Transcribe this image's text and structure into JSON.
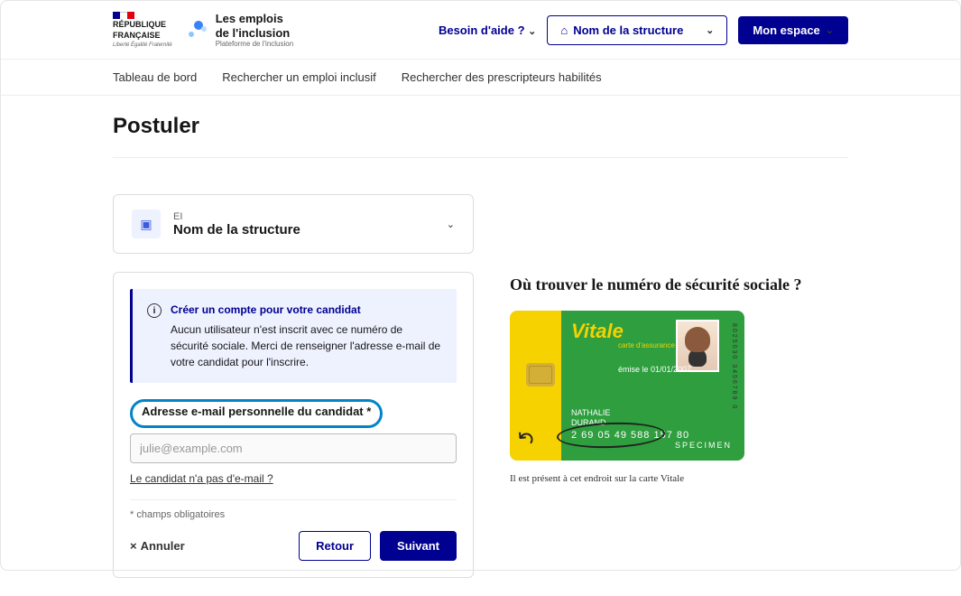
{
  "header": {
    "republic_line1": "République",
    "republic_line2": "Française",
    "motto": "Liberté Égalité Fraternité",
    "brand_line1": "Les emplois",
    "brand_line2": "de l'inclusion",
    "brand_sub": "Plateforme de l'inclusion",
    "help_label": "Besoin d'aide ?",
    "structure_label": "Nom de la structure",
    "account_label": "Mon espace"
  },
  "nav": {
    "item1": "Tableau de bord",
    "item2": "Rechercher un emploi inclusif",
    "item3": "Rechercher des prescripteurs habilités"
  },
  "page": {
    "title": "Postuler"
  },
  "structure_card": {
    "type": "EI",
    "name": "Nom de la structure"
  },
  "info_box": {
    "title": "Créer un compte pour votre candidat",
    "body": "Aucun utilisateur n'est inscrit avec ce numéro de sécurité sociale. Merci de renseigner l'adresse e-mail de votre candidat pour l'inscrire."
  },
  "form": {
    "email_label": "Adresse e-mail personnelle du candidat *",
    "email_placeholder": "julie@example.com",
    "no_email_link": "Le candidat n'a pas d'e-mail ?",
    "mandatory_note": "* champs obligatoires",
    "cancel_label": "Annuler",
    "back_label": "Retour",
    "next_label": "Suivant"
  },
  "side": {
    "title": "Où trouver le numéro de sécurité sociale ?",
    "caption": "Il est présent à cet endroit sur la carte Vitale",
    "vitale": {
      "brand": "Vitale",
      "sub": "carte d'assurance maladie",
      "emise": "émise le 01/01/2007",
      "name_first": "NATHALIE",
      "name_last": "DURAND",
      "number": "2 69 05 49 588 157 80",
      "specimen": "SPECIMEN",
      "barcode": "8025030 3456789 0"
    }
  }
}
